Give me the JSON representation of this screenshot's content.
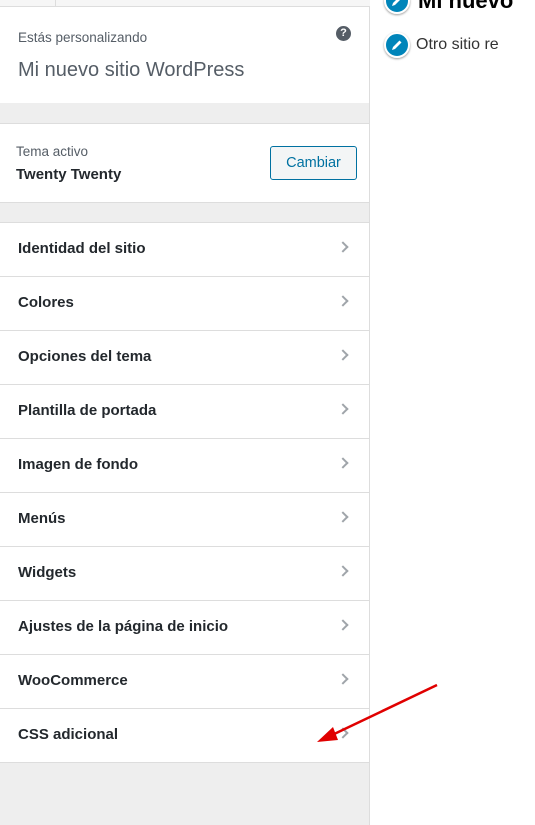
{
  "customizer": {
    "label": "Estás personalizando",
    "site_title": "Mi nuevo sitio WordPress",
    "help_glyph": "?"
  },
  "theme": {
    "label": "Tema activo",
    "name": "Twenty Twenty",
    "change_button": "Cambiar"
  },
  "menu": {
    "items": [
      {
        "label": "Identidad del sitio"
      },
      {
        "label": "Colores"
      },
      {
        "label": "Opciones del tema"
      },
      {
        "label": "Plantilla de portada"
      },
      {
        "label": "Imagen de fondo"
      },
      {
        "label": "Menús"
      },
      {
        "label": "Widgets"
      },
      {
        "label": "Ajustes de la página de inicio"
      },
      {
        "label": "WooCommerce"
      },
      {
        "label": "CSS adicional"
      }
    ]
  },
  "preview": {
    "site_title": "Mi nuevo",
    "tagline": "Otro sitio re"
  },
  "colors": {
    "accent": "#0071a1",
    "edit_shortcut": "#0085ba",
    "annotation_arrow": "#e00000"
  }
}
